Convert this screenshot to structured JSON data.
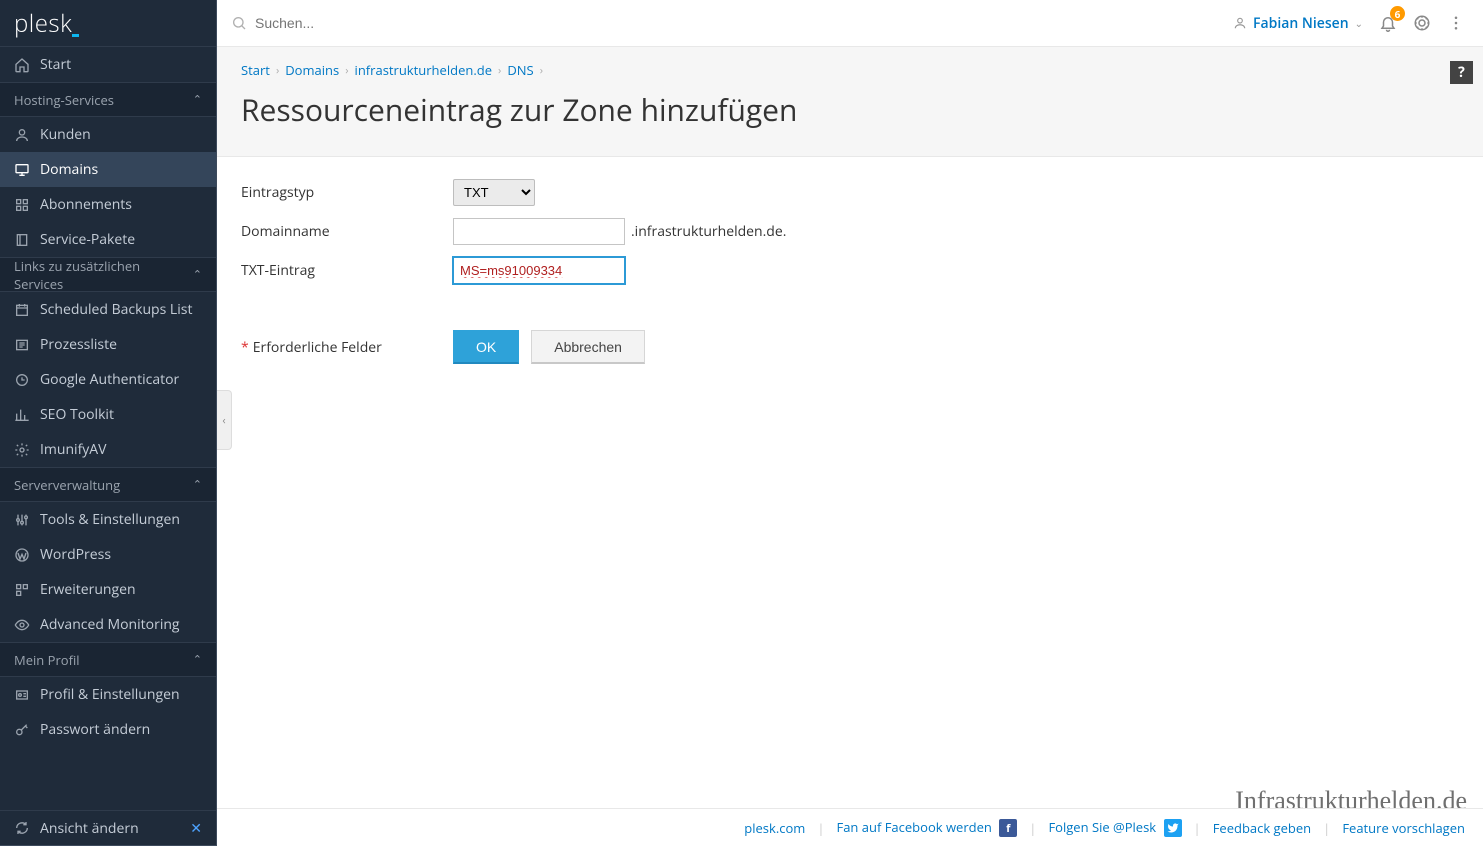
{
  "logo": "plesk",
  "search": {
    "placeholder": "Suchen..."
  },
  "topbar": {
    "user_name": "Fabian Niesen",
    "notifications_count": "6"
  },
  "sidebar": {
    "start": "Start",
    "section_hosting": "Hosting-Services",
    "items_hosting": [
      {
        "label": "Kunden"
      },
      {
        "label": "Domains"
      },
      {
        "label": "Abonnements"
      },
      {
        "label": "Service-Pakete"
      }
    ],
    "section_links": "Links zu zusätzlichen Services",
    "items_links": [
      {
        "label": "Scheduled Backups List"
      },
      {
        "label": "Prozessliste"
      },
      {
        "label": "Google Authenticator"
      },
      {
        "label": "SEO Toolkit"
      },
      {
        "label": "ImunifyAV"
      }
    ],
    "section_server": "Serververwaltung",
    "items_server": [
      {
        "label": "Tools & Einstellungen"
      },
      {
        "label": "WordPress"
      },
      {
        "label": "Erweiterungen"
      },
      {
        "label": "Advanced Monitoring"
      }
    ],
    "section_profile": "Mein Profil",
    "items_profile": [
      {
        "label": "Profil & Einstellungen"
      },
      {
        "label": "Passwort ändern"
      }
    ],
    "view_change": "Ansicht ändern"
  },
  "breadcrumb": {
    "items": [
      "Start",
      "Domains",
      "infrastrukturhelden.de",
      "DNS"
    ]
  },
  "page_title": "Ressourceneintrag zur Zone hinzufügen",
  "help_label": "?",
  "form": {
    "type_label": "Eintragstyp",
    "type_value": "TXT",
    "domain_label": "Domainname",
    "domain_value": "",
    "domain_suffix": ".infrastrukturhelden.de.",
    "txt_label": "TXT-Eintrag",
    "txt_value": "MS=ms91009334",
    "required_note": "Erforderliche Felder",
    "ok_button": "OK",
    "cancel_button": "Abbrechen"
  },
  "watermark": "Infrastrukturhelden.de",
  "footer": {
    "plesk": "plesk.com",
    "facebook": "Fan auf Facebook werden",
    "twitter": "Folgen Sie @Plesk",
    "feedback": "Feedback geben",
    "feature": "Feature vorschlagen"
  }
}
